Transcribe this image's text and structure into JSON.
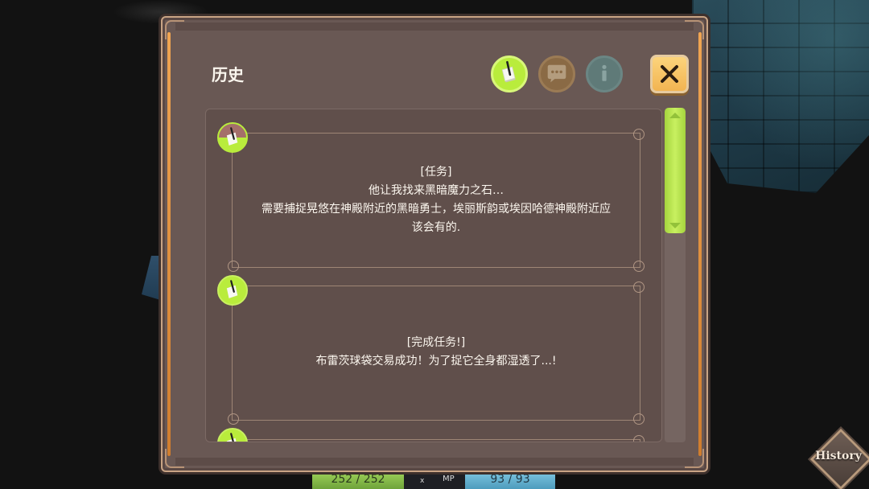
{
  "window": {
    "title": "历史",
    "close_icon": "close-icon"
  },
  "tabs": [
    {
      "name": "quest",
      "icon": "quest-scroll-icon",
      "active": true
    },
    {
      "name": "chat",
      "icon": "chat-bubble-icon",
      "active": false
    },
    {
      "name": "info",
      "icon": "info-icon",
      "active": false
    }
  ],
  "entries": [
    {
      "icon": "quest-scroll-icon",
      "lines": [
        "[任务]",
        "他让我找来黑暗魔力之石…",
        "需要捕捉晃悠在神殿附近的黑暗勇士，埃丽斯韵或埃因哈德神殿附近应",
        "该会有的."
      ]
    },
    {
      "icon": "quest-scroll-icon",
      "lines": [
        "[完成任务!]",
        "布雷茨球袋交易成功！为了捉它全身都湿透了...!"
      ]
    },
    {
      "icon": "quest-scroll-icon",
      "lines": []
    }
  ],
  "scrollbar": {
    "position": 0,
    "visible_fraction": 0.38
  },
  "hud": {
    "hp_text": "252 / 252",
    "mid_marker": "x",
    "mp_label": "MP",
    "mp_text": "93 / 93"
  },
  "history_button": {
    "label": "History"
  },
  "colors": {
    "accent_green": "#b9ec3c",
    "panel": "#695854",
    "close_button": "#f2b452",
    "rail_orange": "#f0a552"
  }
}
